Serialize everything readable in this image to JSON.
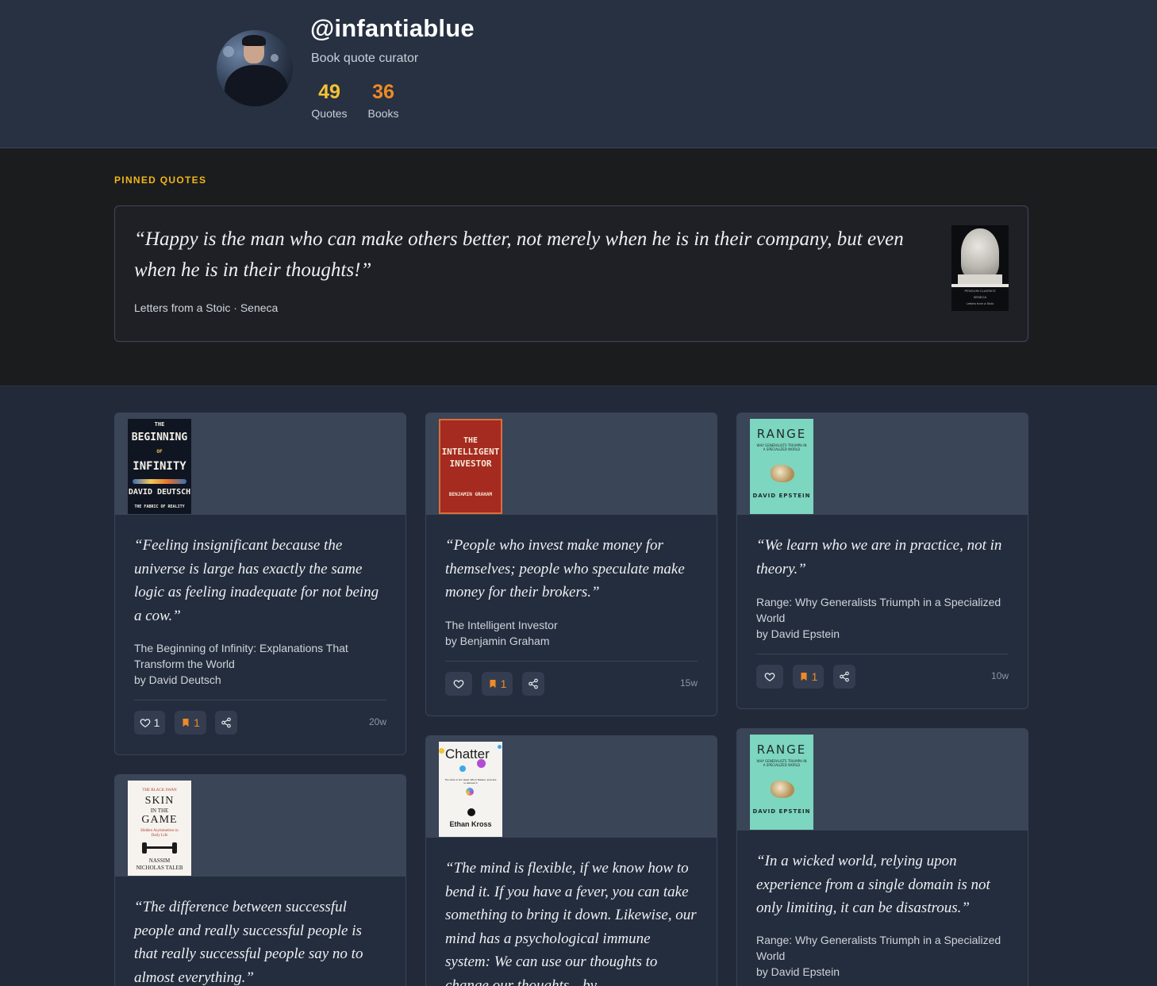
{
  "profile": {
    "handle": "@infantiablue",
    "bio": "Book quote curator",
    "stats": [
      {
        "value": "49",
        "label": "Quotes"
      },
      {
        "value": "36",
        "label": "Books"
      }
    ]
  },
  "pinned": {
    "section_title": "PINNED QUOTES",
    "quote": "“Happy is the man who can make others better, not merely when he is in their company, but even when he is in their thoughts!”",
    "meta": "Letters from a Stoic · Seneca",
    "cover": {
      "series": "PENGUIN CLASSICS",
      "author": "SENECA",
      "title": "Letters from a Stoic"
    }
  },
  "cards": [
    {
      "quote": "“Feeling insignificant because the universe is large has exactly the same logic as feeling inadequate for not being a cow.”",
      "book": "The Beginning of Infinity: Explanations That Transform the World",
      "author": "by David Deutsch",
      "likes": "1",
      "saves": "1",
      "age": "20w",
      "cover": {
        "l1": "THE",
        "l2": "BEGINNING",
        "l3": "OF",
        "l4": "INFINITY",
        "l5": "DAVID DEUTSCH",
        "l6": "THE FABRIC OF REALITY"
      }
    },
    {
      "quote": "“People who invest make money for themselves; people who speculate make money for their brokers.”",
      "book": "The Intelligent Investor",
      "author": "by Benjamin Graham",
      "likes": "",
      "saves": "1",
      "age": "15w",
      "cover": {
        "l1": "THE",
        "l2": "INTELLIGENT",
        "l3": "INVESTOR",
        "l4": "BENJAMIN GRAHAM"
      }
    },
    {
      "quote": "“We learn who we are in practice, not in theory.”",
      "book": "Range: Why Generalists Triumph in a Specialized World",
      "author": "by David Epstein",
      "likes": "",
      "saves": "1",
      "age": "10w",
      "cover": {
        "l1": "RANGE",
        "l2": "WHY GENERALISTS TRIUMPH IN A SPECIALIZED WORLD",
        "l3": "DAVID EPSTEIN"
      }
    },
    {
      "quote": "“The difference between successful people and really successful people is that really successful people say no to almost everything.”",
      "cover": {
        "l1": "THE BLACK SWAN",
        "l2": "SKIN",
        "l3": "IN THE",
        "l4": "GAME",
        "l5": "Hidden Asymmetries in Daily Life",
        "l6": "NASSIM",
        "l7": "NICHOLAS TALEB"
      }
    },
    {
      "quote": "“The mind is flexible, if we know how to bend it. If you have a fever, you can take something to bring it down. Likewise, our mind has a psychological immune system: We can use our thoughts to change our thoughts—by",
      "cover": {
        "l1": "Chatter",
        "l2": "The Voice in Our Head, Why It Matters, and How to Harness It",
        "l3": "Ethan Kross"
      }
    },
    {
      "quote": "“In a wicked world, relying upon experience from a single domain is not only limiting, it can be disastrous.”",
      "book": "Range: Why Generalists Triumph in a Specialized World",
      "author": "by David Epstein",
      "cover": {
        "l1": "RANGE",
        "l2": "WHY GENERALISTS TRIUMPH IN A SPECIALIZED WORLD",
        "l3": "DAVID EPSTEIN"
      }
    }
  ],
  "colors": {
    "accent_yellow": "#f5c232",
    "accent_orange": "#f08a24",
    "header_bg": "#273142",
    "pinned_bg": "#1b1c1e",
    "card_bg": "#242d3d"
  },
  "icons": [
    "heart-icon",
    "bookmark-icon",
    "share-icon"
  ]
}
